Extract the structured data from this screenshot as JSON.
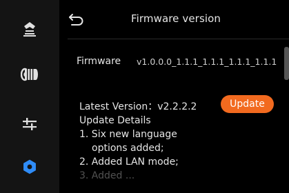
{
  "header": {
    "title": "Firmware version"
  },
  "sidebar": {
    "items": [
      {
        "icon": "printer-icon"
      },
      {
        "icon": "filament-spool-icon"
      },
      {
        "icon": "sliders-icon"
      },
      {
        "icon": "gear-icon",
        "active": true
      }
    ]
  },
  "firmware": {
    "label": "Firmware",
    "value": "v1.0.0.0_1.1.1_1.1.1_1.1.1_1.1.1"
  },
  "update": {
    "latest_version_label": "Latest Version：v2.2.2.2",
    "button_label": "Update",
    "details_title": "Update Details",
    "details_lines": [
      "1. Six new language",
      "options added;",
      "2. Added LAN mode;",
      "3. Added ..."
    ]
  },
  "colors": {
    "accent": "#f26a1f",
    "active_icon": "#2f8cf7",
    "sidebar_bg": "#141414",
    "background": "#000000"
  }
}
